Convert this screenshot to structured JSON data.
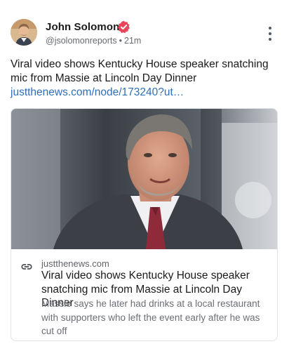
{
  "author": {
    "name": "John Solomon",
    "handle": "@jsolomonreports",
    "separator": "•",
    "time": "21m",
    "avatar_icon": "avatar-photo",
    "verified_color": "#e8455a"
  },
  "post": {
    "text": "Viral video shows Kentucky House speaker snatching mic from Massie at Lincoln Day Dinner",
    "link_text": "justthenews.com/node/173240?ut…"
  },
  "link_card": {
    "domain": "justthenews.com",
    "title": "Viral video shows Kentucky House speaker snatching mic from Massie at Lincoln Day Dinner",
    "description": "Massie says he later had drinks at a local restaurant with supporters who left the event early after he was cut off",
    "icon": "link-icon"
  },
  "colors": {
    "link": "#2f6fb5",
    "text": "#1a1a1a",
    "muted": "#666a70"
  }
}
